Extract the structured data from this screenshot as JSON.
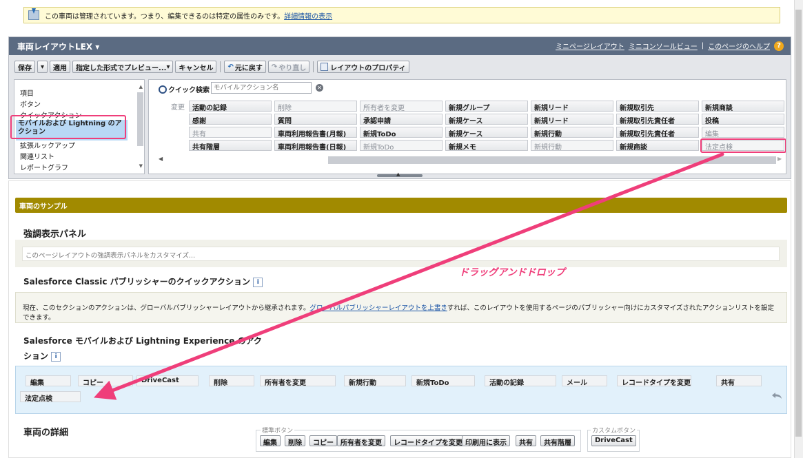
{
  "notice": {
    "text": "この車両は管理されています。つまり、編集できるのは特定の属性のみです。",
    "link": "詳細情報の表示"
  },
  "editor": {
    "title": "車両レイアウトLEX",
    "header_links": [
      "ミニページレイアウト",
      "ミニコンソールビュー",
      "このページのヘルプ"
    ],
    "toolbar": {
      "save": "保存",
      "apply": "適用",
      "preview": "指定した形式でプレビュー...",
      "cancel": "キャンセル",
      "undo": "元に戻す",
      "redo": "やり直し",
      "properties": "レイアウトのプロパティ"
    },
    "palette_categories": [
      "項目",
      "ボタン",
      "クイックアクション",
      "モバイルおよび Lightning のアクション",
      "拡張ルックアップ",
      "関連リスト",
      "レポートグラフ"
    ],
    "quick_search_label": "クイック検索",
    "quick_search_placeholder": "モバイルアクション名",
    "palette_rows": [
      [
        "変更",
        "活動の記録",
        "削除",
        "所有者を変更",
        "新規グループ",
        "新規リード",
        "新規取引先",
        "新規商談"
      ],
      [
        "",
        "感謝",
        "質問",
        "承認申請",
        "新規ケース",
        "新規リード",
        "新規取引先責任者",
        "投稿"
      ],
      [
        "",
        "共有",
        "車両利用報告書(月報)",
        "新規ToDo",
        "新規ケース",
        "新規行動",
        "新規取引先責任者",
        "編集"
      ],
      [
        "",
        "共有階層",
        "車両利用報告書(日報)",
        "新規ToDo",
        "新規メモ",
        "新規行動",
        "新規商談",
        "法定点検"
      ]
    ]
  },
  "layout": {
    "section_title": "車両のサンプル",
    "highlights_title": "強調表示パネル",
    "highlights_hint": "このページレイアウトの強調表示パネルをカスタマイズ...",
    "classic_title": "Salesforce Classic パブリッシャーのクイックアクション",
    "classic_text_before": "現在、このセクションのアクションは、グローバルパブリッシャーレイアウトから継承されます。",
    "classic_link": "グローバルパブリッシャーレイアウトを上書き",
    "classic_text_after": "すれば、このレイアウトを使用するページのパブリッシャー向けにカスタマイズされたアクションリストを設定できます。",
    "mobile_title_1": "Salesforce モバイルおよび Lightning Experience のアク",
    "mobile_title_2": "ション",
    "mobile_actions": [
      "編集",
      "コピー",
      "DriveCast",
      "削除",
      "所有者を変更",
      "新規行動",
      "新規ToDo",
      "活動の記録",
      "メール",
      "レコードタイプを変更",
      "共有",
      "法定点検"
    ],
    "detail_title": "車両の詳細",
    "standard_buttons_legend": "標準ボタン",
    "standard_buttons": [
      "編集",
      "削除",
      "コピー",
      "所有者を変更",
      "レコードタイプを変更",
      "印刷用に表示",
      "共有",
      "共有階層"
    ],
    "custom_buttons_legend": "カスタムボタン",
    "custom_buttons": [
      "DriveCast"
    ]
  },
  "annotation": {
    "drag_drop_label": "ドラッグアンドドロップ",
    "color": "#ef3e7a"
  }
}
